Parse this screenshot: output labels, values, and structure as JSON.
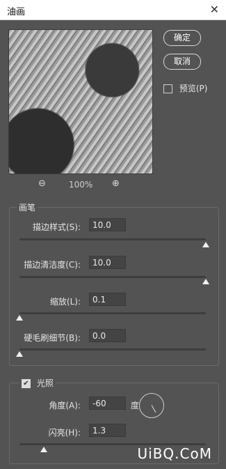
{
  "window": {
    "title": "油画",
    "close_icon": "close-icon"
  },
  "buttons": {
    "ok": "确定",
    "cancel": "取消"
  },
  "preview_toggle": {
    "label": "预览(P)",
    "checked": false
  },
  "zoom": {
    "value": "100%",
    "zoom_out_icon": "zoom-out-icon",
    "zoom_in_icon": "zoom-in-icon"
  },
  "brush": {
    "title": "画笔",
    "stroke_style": {
      "label": "描边样式(S):",
      "value": "10.0",
      "level": 1.0
    },
    "stroke_clean": {
      "label": "描边清洁度(C):",
      "value": "10.0",
      "level": 1.0
    },
    "scale": {
      "label": "缩放(L):",
      "value": "0.1",
      "level": 0.0
    },
    "bristle_detail": {
      "label": "硬毛刷细节(B):",
      "value": "0.0",
      "level": 0.0
    }
  },
  "lighting": {
    "title": "光照",
    "checked": true,
    "angle": {
      "label": "角度(A):",
      "value": "-60",
      "unit": "度"
    },
    "shine": {
      "label": "闪亮(H):",
      "value": "1.3",
      "level": 0.13
    }
  },
  "watermark": "UiBQ.CoM"
}
